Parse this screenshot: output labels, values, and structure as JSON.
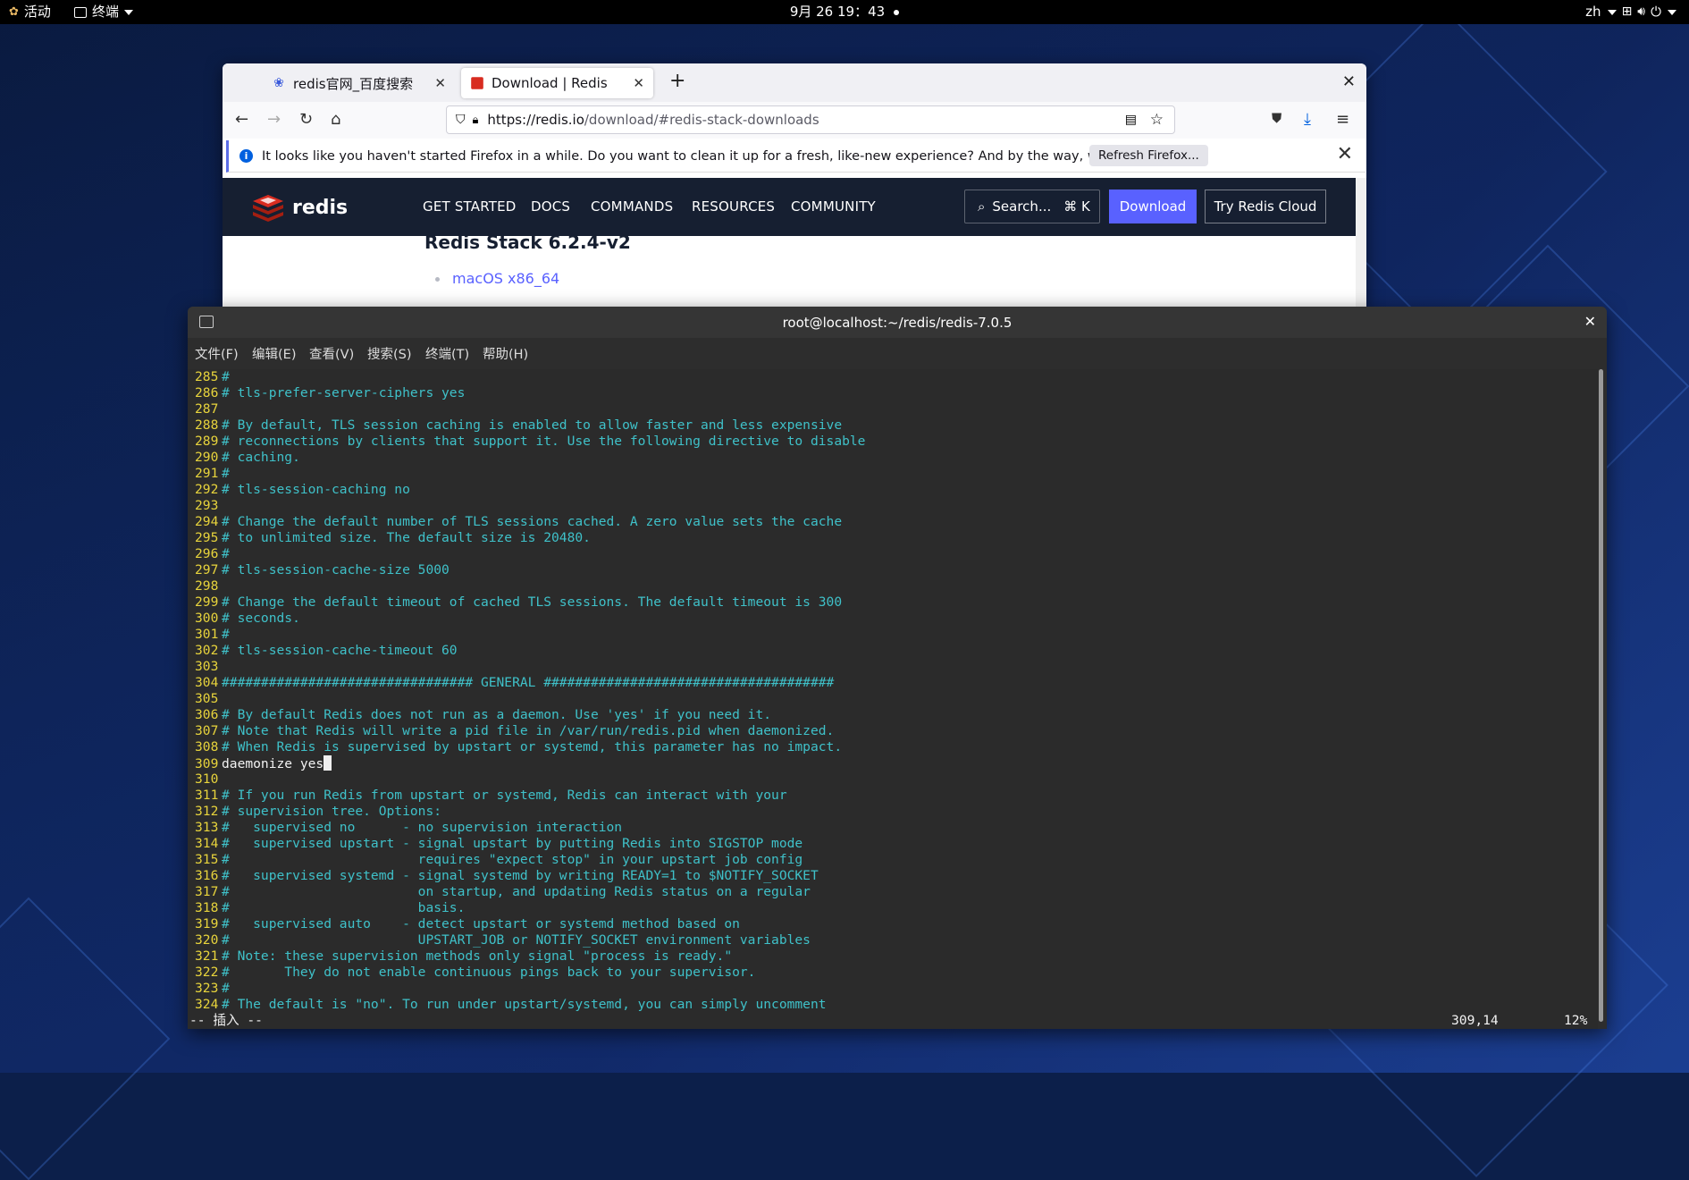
{
  "topbar": {
    "activities": "活动",
    "app_menu": "终端",
    "clock": "9月 26  19：43",
    "lang": "zh"
  },
  "firefox": {
    "tabs": [
      {
        "label": "redis官网_百度搜索",
        "icon": "baidu-paw-icon"
      },
      {
        "label": "Download | Redis",
        "icon": "redis-cube-icon"
      }
    ],
    "url_host": "https://redis.io",
    "url_path": "/download/#redis-stack-downloads",
    "notification": "It looks like you haven't started Firefox in a while. Do you want to clean it up for a fresh, like-new experience? And by the way, welcome back!",
    "refresh_button": "Refresh Firefox...",
    "site": {
      "logo_text": "redis",
      "nav": [
        "GET STARTED",
        "DOCS",
        "COMMANDS",
        "RESOURCES",
        "COMMUNITY"
      ],
      "search_label": "Search...",
      "search_shortcut": "⌘ K",
      "download_btn": "Download",
      "cloud_btn": "Try Redis Cloud",
      "stack_title": "Redis Stack 6.2.4-v2",
      "link_mac": "macOS x86_64"
    },
    "colors": {
      "redis_bg": "#161f31",
      "download_btn": "#5961ff"
    }
  },
  "terminal": {
    "title": "root@localhost:~/redis/redis-7.0.5",
    "menu": [
      "文件(F)",
      "编辑(E)",
      "查看(V)",
      "搜索(S)",
      "终端(T)",
      "帮助(H)"
    ],
    "lines": [
      {
        "n": "285",
        "t": "#",
        "c": true
      },
      {
        "n": "286",
        "t": "# tls-prefer-server-ciphers yes",
        "c": true
      },
      {
        "n": "287",
        "t": "",
        "c": true
      },
      {
        "n": "288",
        "t": "# By default, TLS session caching is enabled to allow faster and less expensive",
        "c": true
      },
      {
        "n": "289",
        "t": "# reconnections by clients that support it. Use the following directive to disable",
        "c": true
      },
      {
        "n": "290",
        "t": "# caching.",
        "c": true
      },
      {
        "n": "291",
        "t": "#",
        "c": true
      },
      {
        "n": "292",
        "t": "# tls-session-caching no",
        "c": true
      },
      {
        "n": "293",
        "t": "",
        "c": true
      },
      {
        "n": "294",
        "t": "# Change the default number of TLS sessions cached. A zero value sets the cache",
        "c": true
      },
      {
        "n": "295",
        "t": "# to unlimited size. The default size is 20480.",
        "c": true
      },
      {
        "n": "296",
        "t": "#",
        "c": true
      },
      {
        "n": "297",
        "t": "# tls-session-cache-size 5000",
        "c": true
      },
      {
        "n": "298",
        "t": "",
        "c": true
      },
      {
        "n": "299",
        "t": "# Change the default timeout of cached TLS sessions. The default timeout is 300",
        "c": true
      },
      {
        "n": "300",
        "t": "# seconds.",
        "c": true
      },
      {
        "n": "301",
        "t": "#",
        "c": true
      },
      {
        "n": "302",
        "t": "# tls-session-cache-timeout 60",
        "c": true
      },
      {
        "n": "303",
        "t": "",
        "c": true
      },
      {
        "n": "304",
        "t": "################################ GENERAL #####################################",
        "c": true
      },
      {
        "n": "305",
        "t": "",
        "c": true
      },
      {
        "n": "306",
        "t": "# By default Redis does not run as a daemon. Use 'yes' if you need it.",
        "c": true
      },
      {
        "n": "307",
        "t": "# Note that Redis will write a pid file in /var/run/redis.pid when daemonized.",
        "c": true
      },
      {
        "n": "308",
        "t": "# When Redis is supervised by upstart or systemd, this parameter has no impact.",
        "c": true
      },
      {
        "n": "309",
        "t": "daemonize yes",
        "c": false,
        "cursor": true
      },
      {
        "n": "310",
        "t": "",
        "c": true
      },
      {
        "n": "311",
        "t": "# If you run Redis from upstart or systemd, Redis can interact with your",
        "c": true
      },
      {
        "n": "312",
        "t": "# supervision tree. Options:",
        "c": true
      },
      {
        "n": "313",
        "t": "#   supervised no      - no supervision interaction",
        "c": true
      },
      {
        "n": "314",
        "t": "#   supervised upstart - signal upstart by putting Redis into SIGSTOP mode",
        "c": true
      },
      {
        "n": "315",
        "t": "#                        requires \"expect stop\" in your upstart job config",
        "c": true
      },
      {
        "n": "316",
        "t": "#   supervised systemd - signal systemd by writing READY=1 to $NOTIFY_SOCKET",
        "c": true
      },
      {
        "n": "317",
        "t": "#                        on startup, and updating Redis status on a regular",
        "c": true
      },
      {
        "n": "318",
        "t": "#                        basis.",
        "c": true
      },
      {
        "n": "319",
        "t": "#   supervised auto    - detect upstart or systemd method based on",
        "c": true
      },
      {
        "n": "320",
        "t": "#                        UPSTART_JOB or NOTIFY_SOCKET environment variables",
        "c": true
      },
      {
        "n": "321",
        "t": "# Note: these supervision methods only signal \"process is ready.\"",
        "c": true
      },
      {
        "n": "322",
        "t": "#       They do not enable continuous pings back to your supervisor.",
        "c": true
      },
      {
        "n": "323",
        "t": "#",
        "c": true
      },
      {
        "n": "324",
        "t": "# The default is \"no\". To run under upstart/systemd, you can simply uncomment",
        "c": true
      }
    ],
    "mode": "-- 插入 --",
    "position": "309,14",
    "percent": "12%",
    "colors": {
      "line_numbers": "#e8d43c",
      "comments": "#3fc1c9",
      "bg": "#2b2b2b"
    }
  }
}
